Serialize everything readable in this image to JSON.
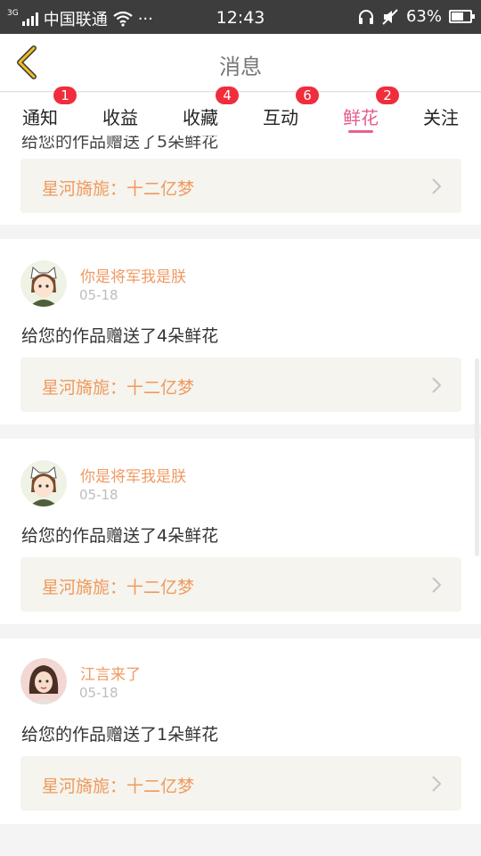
{
  "status_bar": {
    "network_type": "3G",
    "carrier": "中国联通",
    "more": "···",
    "time": "12:43",
    "battery_percent": "63%",
    "battery_level": 0.63
  },
  "header": {
    "title": "消息",
    "back_icon": "chevron-left-icon",
    "accent_color": "#f0c020"
  },
  "tabs": [
    {
      "label": "通知",
      "badge": "1"
    },
    {
      "label": "收益",
      "badge": ""
    },
    {
      "label": "收藏",
      "badge": "4"
    },
    {
      "label": "互动",
      "badge": "6"
    },
    {
      "label": "鲜花",
      "badge": "2",
      "active": true
    },
    {
      "label": "关注",
      "badge": ""
    }
  ],
  "messages": {
    "partial_top": {
      "text": "给您的作品赠送了5朵鲜花",
      "work_title": "星河旖旎：十二亿梦"
    },
    "items": [
      {
        "username": "你是将军我是朕",
        "date": "05-18",
        "message": "给您的作品赠送了4朵鲜花",
        "work_title": "星河旖旎：十二亿梦",
        "avatar": "cat-girl-avatar"
      },
      {
        "username": "你是将军我是朕",
        "date": "05-18",
        "message": "给您的作品赠送了4朵鲜花",
        "work_title": "星河旖旎：十二亿梦",
        "avatar": "cat-girl-avatar"
      },
      {
        "username": "江言来了",
        "date": "05-18",
        "message": "给您的作品赠送了1朵鲜花",
        "work_title": "星河旖旎：十二亿梦",
        "avatar": "woman-portrait-avatar"
      }
    ]
  },
  "colors": {
    "username": "#f09a62",
    "active_tab": "#e45a8e",
    "badge": "#f02d3c",
    "work_box_bg": "#f5f4ee"
  }
}
